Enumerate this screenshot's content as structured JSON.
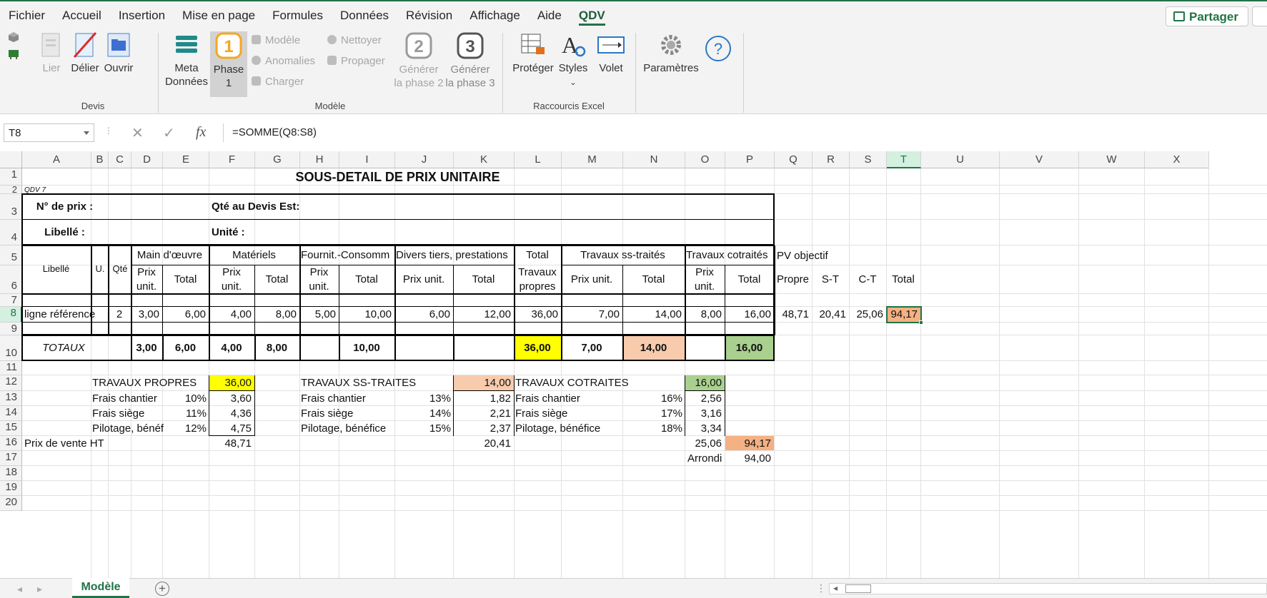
{
  "menu": {
    "tabs": [
      "Fichier",
      "Accueil",
      "Insertion",
      "Mise en page",
      "Formules",
      "Données",
      "Révision",
      "Affichage",
      "Aide",
      "QDV"
    ],
    "active_tab": "QDV",
    "share_label": "Partager"
  },
  "ribbon": {
    "devis": {
      "label": "Devis",
      "lier": "Lier",
      "delier": "Délier",
      "ouvrir": "Ouvrir"
    },
    "modele": {
      "label": "Modèle",
      "meta_1": "Meta",
      "meta_2": "Données",
      "phase1_1": "Phase",
      "phase1_2": "1",
      "phase1_num": "1",
      "modele_btn": "Modèle",
      "anomalies": "Anomalies",
      "charger": "Charger",
      "nettoyer": "Nettoyer",
      "propager": "Propager",
      "gen2_num": "2",
      "gen2_1": "Générer",
      "gen2_2": "la phase 2",
      "gen3_num": "3",
      "gen3_1": "Générer",
      "gen3_2": "la phase 3"
    },
    "raccourcis": {
      "label": "Raccourcis Excel",
      "proteger": "Protéger",
      "styles": "Styles",
      "volet": "Volet"
    },
    "parametres": "Paramètres"
  },
  "formula_bar": {
    "name_box": "T8",
    "formula": "=SOMME(Q8:S8)",
    "fx": "fx"
  },
  "columns": [
    "A",
    "B",
    "C",
    "D",
    "E",
    "F",
    "G",
    "H",
    "I",
    "J",
    "K",
    "L",
    "M",
    "N",
    "O",
    "P",
    "Q",
    "R",
    "S",
    "T",
    "U",
    "V",
    "W",
    "X"
  ],
  "rows": [
    "1",
    "2",
    "3",
    "4",
    "5",
    "6",
    "7",
    "8",
    "9",
    "10",
    "11",
    "12",
    "13",
    "14",
    "15",
    "16",
    "17",
    "18",
    "19",
    "20"
  ],
  "sheet": {
    "title": "SOUS-DETAIL DE PRIX UNITAIRE",
    "qdv_tag": "QDV 7",
    "n_prix_label": "N° de prix :",
    "qte_devis_label": "Qté au Devis Est:",
    "libelle_label": "Libellé :",
    "unite_label": "Unité :",
    "headers": {
      "libelle": "Libellé",
      "u": "U.",
      "qte": "Qté",
      "main_oeuvre": "Main d'œuvre",
      "materiels": "Matériels",
      "fournit": "Fournit.-Consomm",
      "divers": "Divers tiers, prestations",
      "total_travaux_1": "Total",
      "total_travaux_2": "Travaux",
      "total_travaux_3": "propres",
      "ss_traites": "Travaux ss-traités",
      "cotraites": "Travaux cotraités",
      "prix": "Prix",
      "unit": "unit.",
      "total": "Total",
      "prix_unit": "Prix unit.",
      "pv_objectif": "PV objectif",
      "propre": "Propre",
      "s_t": "S-T",
      "c_t": "C-T",
      "total_pv": "Total"
    },
    "row8": {
      "libelle": "ligne référence",
      "qte": "2",
      "d": "3,00",
      "e": "6,00",
      "f": "4,00",
      "g": "8,00",
      "h": "5,00",
      "i": "10,00",
      "j": "6,00",
      "k": "12,00",
      "l": "36,00",
      "m": "7,00",
      "n": "14,00",
      "o": "8,00",
      "p": "16,00",
      "q": "48,71",
      "r": "20,41",
      "s": "25,06",
      "t": "94,17"
    },
    "totaux": {
      "label": "TOTAUX",
      "d": "3,00",
      "e": "6,00",
      "f": "4,00",
      "g": "8,00",
      "i": "10,00",
      "l": "36,00",
      "m": "7,00",
      "n": "14,00",
      "p": "16,00"
    },
    "recap_propres": {
      "title": "TRAVAUX PROPRES",
      "value": "36,00",
      "rows": [
        {
          "label": "Frais chantier",
          "pct": "10%",
          "val": "3,60"
        },
        {
          "label": "Frais siège",
          "pct": "11%",
          "val": "4,36"
        },
        {
          "label": "Pilotage, bénéf",
          "pct": "12%",
          "val": "4,75"
        }
      ],
      "pv": "48,71"
    },
    "recap_sstraites": {
      "title": "TRAVAUX SS-TRAITES",
      "value": "14,00",
      "rows": [
        {
          "label": "Frais chantier",
          "pct": "13%",
          "val": "1,82"
        },
        {
          "label": "Frais siège",
          "pct": "14%",
          "val": "2,21"
        },
        {
          "label": "Pilotage, bénéfice",
          "pct": "15%",
          "val": "2,37"
        }
      ],
      "pv": "20,41"
    },
    "recap_cotraites": {
      "title": "TRAVAUX COTRAITES",
      "value": "16,00",
      "rows": [
        {
          "label": "Frais chantier",
          "pct": "16%",
          "val": "2,56"
        },
        {
          "label": "Frais siège",
          "pct": "17%",
          "val": "3,16"
        },
        {
          "label": "Pilotage, bénéfice",
          "pct": "18%",
          "val": "3,34"
        }
      ],
      "pv": "25,06"
    },
    "prix_vente_label": "Prix de vente HT",
    "prix_vente_total": "94,17",
    "arrondi_label": "Arrondi",
    "arrondi_value": "94,00"
  },
  "sheet_tab": "Modèle",
  "colors": {
    "yellow": "#ffff00",
    "salmon": "#f8cbad",
    "green": "#a9d08e",
    "orange": "#f4b183",
    "accent": "#217346"
  }
}
